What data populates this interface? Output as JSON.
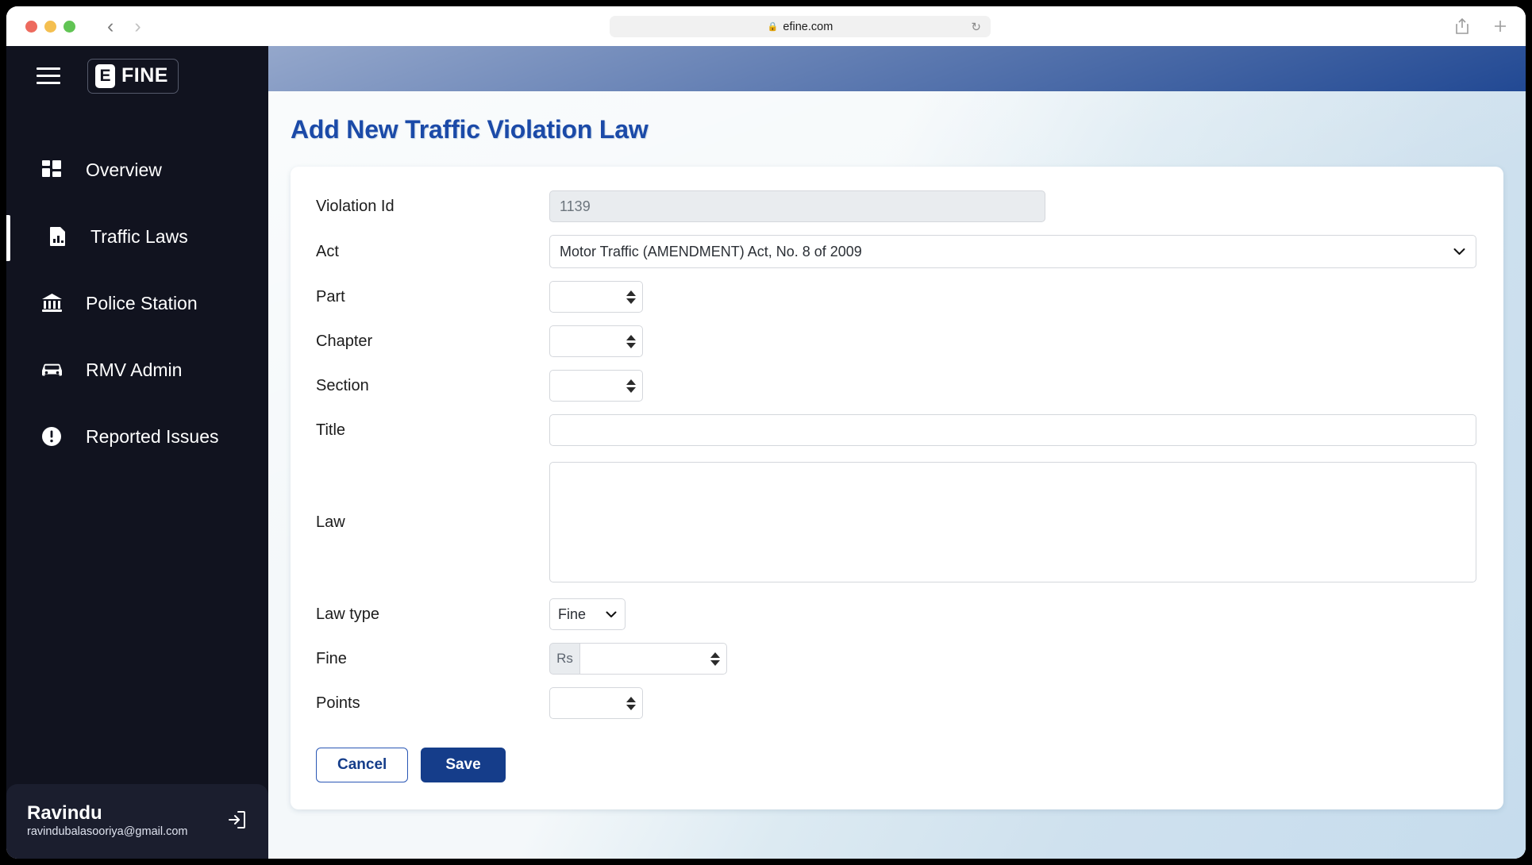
{
  "browser": {
    "url": "efine.com",
    "lock_icon": "lock-icon",
    "reload_icon": "reload-icon",
    "back_icon": "back-arrow-icon",
    "forward_icon": "forward-arrow-icon",
    "share_icon": "share-icon",
    "newtab_icon": "plus-icon",
    "traffic_lights": [
      "close",
      "minimize",
      "maximize"
    ]
  },
  "sidebar": {
    "menu_icon": "hamburger-icon",
    "logo_mark": "E",
    "logo_text": "FINE",
    "items": [
      {
        "label": "Overview",
        "icon": "grid-icon",
        "active": false
      },
      {
        "label": "Traffic Laws",
        "icon": "document-icon",
        "active": true
      },
      {
        "label": "Police Station",
        "icon": "bank-icon",
        "active": false
      },
      {
        "label": "RMV Admin",
        "icon": "car-icon",
        "active": false
      },
      {
        "label": "Reported Issues",
        "icon": "alert-icon",
        "active": false
      }
    ],
    "user": {
      "name": "Ravindu",
      "email": "ravindubalasooriya@gmail.com",
      "logout_icon": "logout-icon"
    }
  },
  "header": {
    "bar_color": "#123c8c"
  },
  "page": {
    "title": "Add New Traffic Violation Law",
    "title_color": "#1b4aa8"
  },
  "form": {
    "violation_id": {
      "label": "Violation Id",
      "value": "1139",
      "readonly": true
    },
    "act": {
      "label": "Act",
      "value": "Motor Traffic (AMENDMENT) Act, No. 8 of 2009",
      "options": [
        "Motor Traffic (AMENDMENT) Act, No. 8 of 2009"
      ],
      "chevron": "chevron-down-icon"
    },
    "part": {
      "label": "Part",
      "value": "",
      "placeholder": ""
    },
    "chapter": {
      "label": "Chapter",
      "value": "",
      "placeholder": ""
    },
    "section": {
      "label": "Section",
      "value": "",
      "placeholder": ""
    },
    "title": {
      "label": "Title",
      "value": "",
      "placeholder": ""
    },
    "law": {
      "label": "Law",
      "value": "",
      "placeholder": ""
    },
    "law_type": {
      "label": "Law type",
      "value": "Fine",
      "options": [
        "Fine"
      ],
      "chevron": "chevron-down-icon"
    },
    "fine": {
      "label": "Fine",
      "prefix": "Rs",
      "value": "",
      "placeholder": ""
    },
    "points": {
      "label": "Points",
      "value": "",
      "placeholder": ""
    },
    "buttons": {
      "cancel": "Cancel",
      "save": "Save"
    }
  }
}
